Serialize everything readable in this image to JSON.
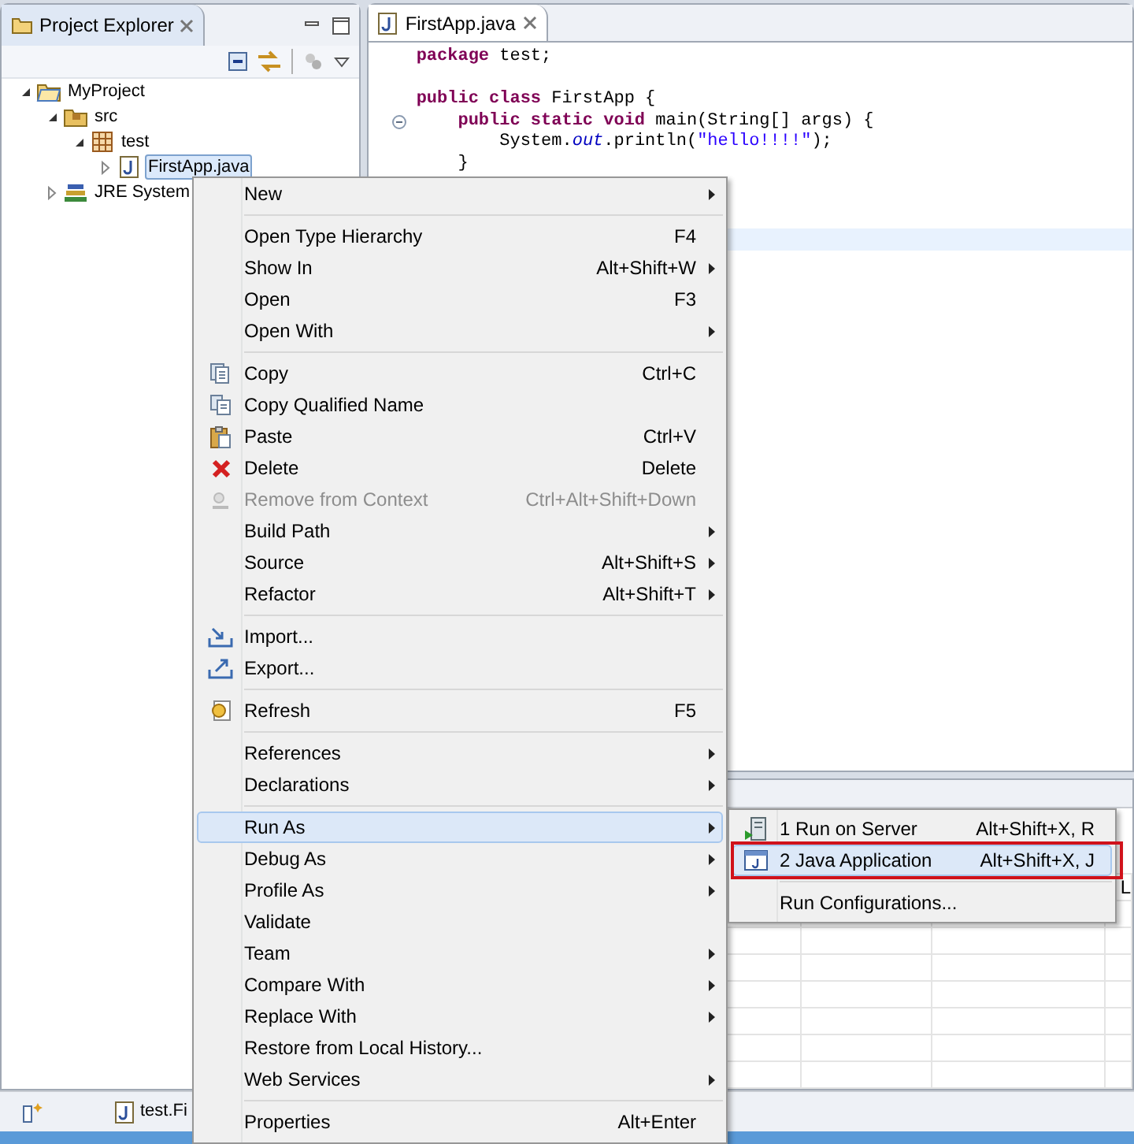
{
  "project_explorer": {
    "title": "Project Explorer",
    "tree": [
      {
        "label": "MyProject",
        "kind": "project",
        "expanded": true,
        "selected": false,
        "children": [
          {
            "label": "src",
            "kind": "source-folder",
            "expanded": true,
            "selected": false,
            "children": [
              {
                "label": "test",
                "kind": "package",
                "expanded": true,
                "selected": false,
                "children": [
                  {
                    "label": "FirstApp.java",
                    "kind": "java-file",
                    "expanded": false,
                    "selected": true
                  }
                ]
              }
            ]
          },
          {
            "label": "JRE System",
            "kind": "library",
            "expanded": false,
            "selected": false
          }
        ]
      }
    ]
  },
  "editor": {
    "tab_title": "FirstApp.java",
    "lines": [
      {
        "kind": "code",
        "fold": false,
        "tokens": [
          {
            "text": "package",
            "kind": "keyword"
          },
          {
            "text": " test;",
            "kind": "plain"
          }
        ]
      },
      {
        "kind": "blank"
      },
      {
        "kind": "code",
        "fold": false,
        "tokens": [
          {
            "text": "public class",
            "kind": "keyword"
          },
          {
            "text": " FirstApp {",
            "kind": "plain"
          }
        ]
      },
      {
        "kind": "code",
        "fold": true,
        "tokens": [
          {
            "text": "    public static void",
            "kind": "keyword"
          },
          {
            "text": " main(String[] args) {",
            "kind": "plain"
          }
        ]
      },
      {
        "kind": "code",
        "fold": false,
        "tokens": [
          {
            "text": "        System.",
            "kind": "plain"
          },
          {
            "text": "out",
            "kind": "field"
          },
          {
            "text": ".println(",
            "kind": "plain"
          },
          {
            "text": "\"hello!!!!\"",
            "kind": "string"
          },
          {
            "text": ");",
            "kind": "plain"
          }
        ]
      },
      {
        "kind": "code",
        "fold": false,
        "tokens": [
          {
            "text": "    }",
            "kind": "plain"
          }
        ]
      }
    ]
  },
  "lower_view": {
    "cell_text": "L"
  },
  "bottom_bar": {
    "label": "test.Fi"
  },
  "context_menu": [
    {
      "kind": "item",
      "label": "New",
      "submenu": true,
      "disabled": false,
      "selected": false
    },
    {
      "kind": "separator"
    },
    {
      "kind": "item",
      "label": "Open Type Hierarchy",
      "shortcut": "F4",
      "submenu": false,
      "disabled": false,
      "selected": false
    },
    {
      "kind": "item",
      "label": "Show In",
      "shortcut": "Alt+Shift+W",
      "submenu": true,
      "disabled": false,
      "selected": false
    },
    {
      "kind": "item",
      "label": "Open",
      "shortcut": "F3",
      "submenu": false,
      "disabled": false,
      "selected": false
    },
    {
      "kind": "item",
      "label": "Open With",
      "submenu": true,
      "disabled": false,
      "selected": false
    },
    {
      "kind": "separator"
    },
    {
      "kind": "copy",
      "label": "Copy",
      "shortcut": "Ctrl+C",
      "submenu": false,
      "disabled": false,
      "selected": false
    },
    {
      "kind": "copy-qualified",
      "label": "Copy Qualified Name",
      "submenu": false,
      "disabled": false,
      "selected": false
    },
    {
      "kind": "paste",
      "label": "Paste",
      "shortcut": "Ctrl+V",
      "submenu": false,
      "disabled": false,
      "selected": false
    },
    {
      "kind": "delete",
      "label": "Delete",
      "shortcut": "Delete",
      "submenu": false,
      "disabled": false,
      "selected": false
    },
    {
      "kind": "remove",
      "label": "Remove from Context",
      "shortcut": "Ctrl+Alt+Shift+Down",
      "submenu": false,
      "disabled": true,
      "selected": false
    },
    {
      "kind": "item",
      "label": "Build Path",
      "submenu": true,
      "disabled": false,
      "selected": false
    },
    {
      "kind": "item",
      "label": "Source",
      "shortcut": "Alt+Shift+S",
      "submenu": true,
      "disabled": false,
      "selected": false
    },
    {
      "kind": "item",
      "label": "Refactor",
      "shortcut": "Alt+Shift+T",
      "submenu": true,
      "disabled": false,
      "selected": false
    },
    {
      "kind": "separator"
    },
    {
      "kind": "import",
      "label": "Import...",
      "submenu": false,
      "disabled": false,
      "selected": false
    },
    {
      "kind": "export",
      "label": "Export...",
      "submenu": false,
      "disabled": false,
      "selected": false
    },
    {
      "kind": "separator"
    },
    {
      "kind": "refresh",
      "label": "Refresh",
      "shortcut": "F5",
      "submenu": false,
      "disabled": false,
      "selected": false
    },
    {
      "kind": "separator"
    },
    {
      "kind": "item",
      "label": "References",
      "submenu": true,
      "disabled": false,
      "selected": false
    },
    {
      "kind": "item",
      "label": "Declarations",
      "submenu": true,
      "disabled": false,
      "selected": false
    },
    {
      "kind": "separator"
    },
    {
      "kind": "item",
      "label": "Run As",
      "submenu": true,
      "disabled": false,
      "selected": true
    },
    {
      "kind": "item",
      "label": "Debug As",
      "submenu": true,
      "disabled": false,
      "selected": false
    },
    {
      "kind": "item",
      "label": "Profile As",
      "submenu": true,
      "disabled": false,
      "selected": false
    },
    {
      "kind": "item",
      "label": "Validate",
      "submenu": false,
      "disabled": false,
      "selected": false
    },
    {
      "kind": "item",
      "label": "Team",
      "submenu": true,
      "disabled": false,
      "selected": false
    },
    {
      "kind": "item",
      "label": "Compare With",
      "submenu": true,
      "disabled": false,
      "selected": false
    },
    {
      "kind": "item",
      "label": "Replace With",
      "submenu": true,
      "disabled": false,
      "selected": false
    },
    {
      "kind": "item",
      "label": "Restore from Local History...",
      "submenu": false,
      "disabled": false,
      "selected": false
    },
    {
      "kind": "item",
      "label": "Web Services",
      "submenu": true,
      "disabled": false,
      "selected": false
    },
    {
      "kind": "separator"
    },
    {
      "kind": "item",
      "label": "Properties",
      "shortcut": "Alt+Enter",
      "submenu": false,
      "disabled": false,
      "selected": false
    }
  ],
  "run_as_submenu": [
    {
      "kind": "server",
      "label": "1 Run on Server",
      "shortcut": "Alt+Shift+X, R",
      "selected": false,
      "outlined": false
    },
    {
      "kind": "java-app",
      "label": "2 Java Application",
      "shortcut": "Alt+Shift+X, J",
      "selected": true,
      "outlined": true
    },
    {
      "kind": "separator"
    },
    {
      "kind": "item",
      "label": "Run Configurations...",
      "selected": false,
      "outlined": false
    }
  ]
}
